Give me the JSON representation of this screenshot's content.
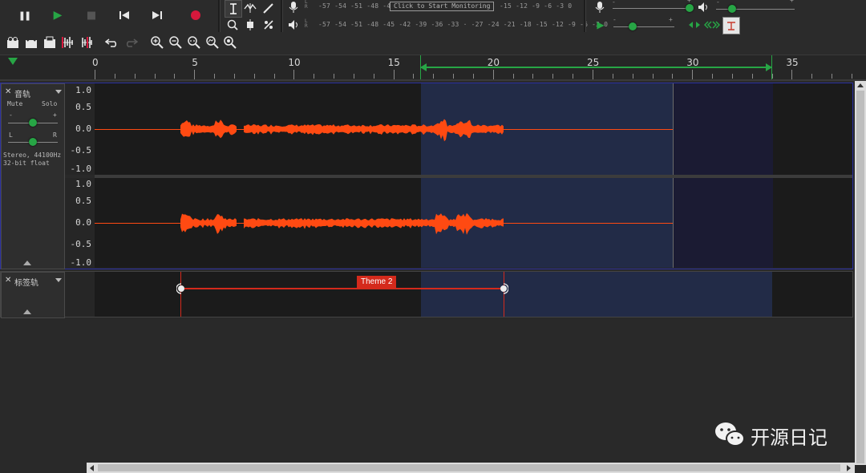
{
  "transport": {
    "pause_label": "❚❚",
    "play_label": "▶",
    "stop_label": "■",
    "skip_start_label": "⏮",
    "skip_end_label": "⏭",
    "record_label": "●"
  },
  "meters": {
    "record_scale": "-57 -54 -51 -48 -45 -42 -39 -36 -33 -30 -27 -24 -21 -18 -15 -12  -9  -6  -3  0",
    "monitor_label": "Click to Start Monitoring",
    "monitor_right_scale": "-15 -12  -9  -6  -3  0",
    "playback_scale": "-57 -54 -51 -48 -45 -42 -39 -36 -33  ·  -27 -24 -21 -18 -15 -12  -9  -6  -3  0",
    "record_scale_left": "-57 -54 -51 -48 -45",
    "lr_left": "L",
    "lr_right": "R"
  },
  "mixer": {
    "minus": "-",
    "plus": "+"
  },
  "ruler": {
    "ticks": [
      "0",
      "5",
      "10",
      "15",
      "20",
      "25",
      "30",
      "35"
    ]
  },
  "audio_track": {
    "name": "音轨",
    "mute_label": "Mute",
    "solo_label": "Solo",
    "gain_minus": "-",
    "gain_plus": "+",
    "pan_left": "L",
    "pan_right": "R",
    "format_line1": "Stereo, 44100Hz",
    "format_line2": "32-bit float",
    "scale": [
      "1.0",
      "0.5",
      "0.0",
      "-0.5",
      "-1.0"
    ],
    "wave_color": "#ff4a12"
  },
  "label_track": {
    "name": "标签轨",
    "label_text": "Theme 2",
    "label_color": "#d42a1c"
  },
  "colors": {
    "selection": "#222b47",
    "selection_dark": "#1b1b33",
    "play_green": "#27a545",
    "record_red": "#d7183c"
  },
  "watermark": {
    "text": "开源日记"
  }
}
